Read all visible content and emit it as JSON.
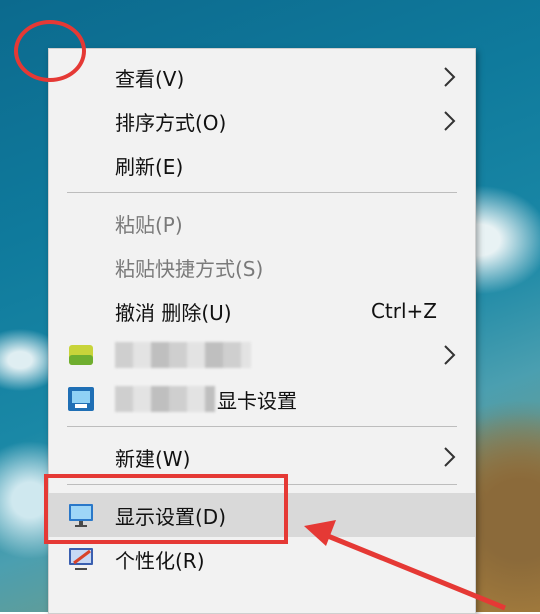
{
  "menu": {
    "items": [
      {
        "label": "查看(V)",
        "submenu": true
      },
      {
        "label": "排序方式(O)",
        "submenu": true
      },
      {
        "label": "刷新(E)"
      },
      {
        "label": "粘贴(P)",
        "disabled": true
      },
      {
        "label": "粘贴快捷方式(S)",
        "disabled": true
      },
      {
        "label": "撤消 删除(U)",
        "shortcut": "Ctrl+Z"
      },
      {
        "label": "",
        "submenu": true,
        "icon": "app-icon",
        "obscured": true
      },
      {
        "label": "显卡设置",
        "icon": "intel-graphics-icon",
        "obscured_prefix": true
      },
      {
        "label": "新建(W)",
        "submenu": true
      },
      {
        "label": "显示设置(D)",
        "icon": "monitor-icon",
        "highlighted": true
      },
      {
        "label": "个性化(R)",
        "icon": "personalize-icon"
      }
    ]
  },
  "annotation": {
    "color": "#e53935"
  },
  "colors": {
    "menu_bg": "#f2f2f2",
    "hover_bg": "#d9d9d9",
    "disabled_text": "#7a7a7a"
  }
}
